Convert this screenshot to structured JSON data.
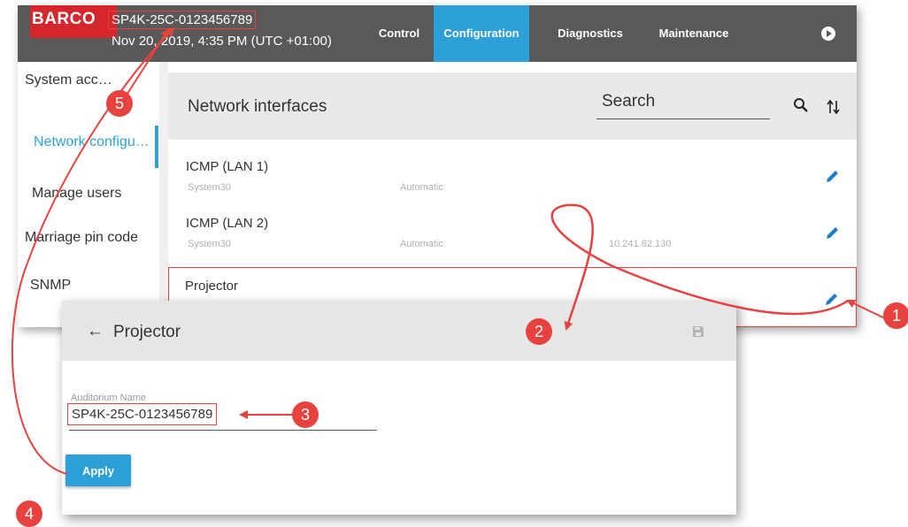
{
  "header": {
    "logo_text": "BARCO",
    "device_name": "SP4K-25C-0123456789",
    "datetime": "Nov 20, 2019, 4:35 PM (UTC +01:00)",
    "tabs": [
      {
        "label": "Control",
        "active": false
      },
      {
        "label": "Configuration",
        "active": true
      },
      {
        "label": "Diagnostics",
        "active": false
      },
      {
        "label": "Maintenance",
        "active": false
      }
    ],
    "accent_color": "#2d9fd9",
    "brand_color": "#d4262b"
  },
  "sidebar": {
    "items": [
      {
        "label": "System acc…",
        "active": false
      },
      {
        "label": "Network configu…",
        "active": true
      },
      {
        "label": "Manage users",
        "active": false
      },
      {
        "label": "Marriage pin code",
        "active": false
      },
      {
        "label": "SNMP",
        "active": false
      }
    ]
  },
  "panel": {
    "title": "Network interfaces",
    "search_label": "Search",
    "rows": [
      {
        "name": "ICMP (LAN 1)",
        "host": "System30",
        "mode": "Automatic",
        "ip": ""
      },
      {
        "name": "ICMP (LAN 2)",
        "host": "System30",
        "mode": "Automatic",
        "ip": "10.241.62.130"
      },
      {
        "name": "Projector",
        "host": "",
        "mode": "",
        "ip": ""
      }
    ]
  },
  "dialog": {
    "back_arrow": "←",
    "title": "Projector",
    "field_label": "Auditorium Name",
    "field_value": "SP4K-25C-0123456789",
    "apply_label": "Apply"
  },
  "callouts": [
    "1",
    "2",
    "3",
    "4",
    "5"
  ],
  "icons": [
    "search-icon",
    "sort-icon",
    "edit-pencil-icon",
    "save-icon",
    "play-icon",
    "back-arrow-icon"
  ]
}
